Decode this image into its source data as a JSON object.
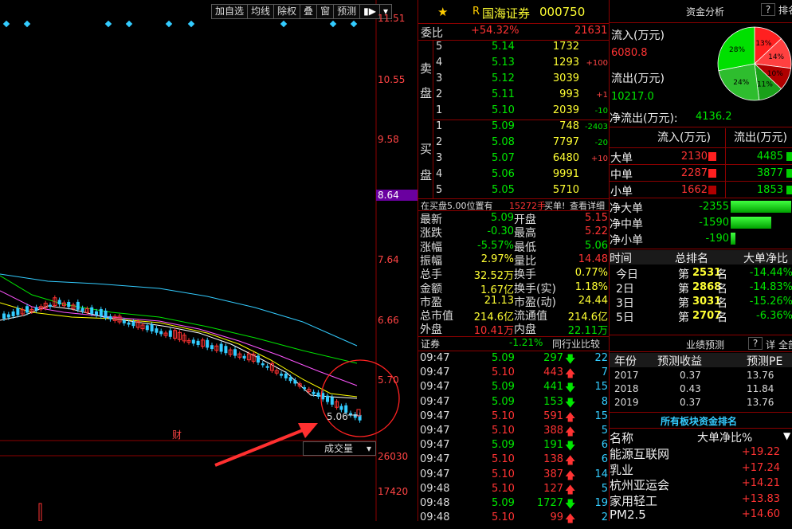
{
  "toolbar": {
    "add": "加自选",
    "ma": "均线",
    "xr": "除权",
    "overlay": "叠",
    "window": "窗",
    "forecast": "预测"
  },
  "price_axis": [
    "11.51",
    "10.55",
    "9.58",
    "8.64",
    "7.64",
    "6.66",
    "5.70"
  ],
  "current_axis_price": "8.64",
  "vol_axis": [
    "26030",
    "17420"
  ],
  "chart": {
    "low_label": "5.06",
    "fin_marker": "财",
    "volume_label": "成交量",
    "lines": {
      "ma1": "#ffffff",
      "ma2": "#ffff00",
      "ma3": "#ff55ff",
      "ma4": "#00e600",
      "ma5": "#33ccff"
    }
  },
  "stock": {
    "flag": "R",
    "name": "国海证券",
    "code": "000750"
  },
  "weibi": {
    "label": "委比",
    "pct": "+54.32%",
    "val": "21631"
  },
  "sell_label": [
    "卖",
    "盘"
  ],
  "buy_label": [
    "买",
    "盘"
  ],
  "sell": [
    {
      "n": "5",
      "p": "5.14",
      "v": "1732",
      "c": ""
    },
    {
      "n": "4",
      "p": "5.13",
      "v": "1293",
      "c": "+100"
    },
    {
      "n": "3",
      "p": "5.12",
      "v": "3039",
      "c": ""
    },
    {
      "n": "2",
      "p": "5.11",
      "v": "993",
      "c": "+1"
    },
    {
      "n": "1",
      "p": "5.10",
      "v": "2039",
      "c": "-10"
    }
  ],
  "buy": [
    {
      "n": "1",
      "p": "5.09",
      "v": "748",
      "c": "-2403"
    },
    {
      "n": "2",
      "p": "5.08",
      "v": "7797",
      "c": "-20"
    },
    {
      "n": "3",
      "p": "5.07",
      "v": "6480",
      "c": "+10"
    },
    {
      "n": "4",
      "p": "5.06",
      "v": "9991",
      "c": ""
    },
    {
      "n": "5",
      "p": "5.05",
      "v": "5710",
      "c": ""
    }
  ],
  "notice": {
    "a": "在买盘5.00位置有",
    "b": "15272手",
    "c": "买单!",
    "d": "查看详细"
  },
  "quote": [
    {
      "l": "最新",
      "v": "5.09",
      "l2": "开盘",
      "v2": "5.15"
    },
    {
      "l": "涨跌",
      "v": "-0.30",
      "l2": "最高",
      "v2": "5.22"
    },
    {
      "l": "涨幅",
      "v": "-5.57%",
      "l2": "最低",
      "v2": "5.06"
    },
    {
      "l": "振幅",
      "v": "2.97%",
      "l2": "量比",
      "v2": "14.48"
    },
    {
      "l": "总手",
      "v": "32.52万",
      "l2": "换手",
      "v2": "0.77%"
    },
    {
      "l": "金额",
      "v": "1.67亿",
      "l2": "换手(实)",
      "v2": "1.18%"
    },
    {
      "l": "市盈",
      "v": "21.13",
      "l2": "市盈(动)",
      "v2": "24.44"
    },
    {
      "l": "总市值",
      "v": "214.6亿",
      "l2": "流通值",
      "v2": "214.6亿"
    },
    {
      "l": "外盘",
      "v": "10.41万",
      "l2": "内盘",
      "v2": "22.11万"
    }
  ],
  "sector": {
    "name": "证券",
    "pct": "-1.21%",
    "btn": "同行业比较"
  },
  "ticks": [
    {
      "t": "09:47",
      "p": "5.09",
      "v": "297",
      "d": "dn",
      "n": "22"
    },
    {
      "t": "09:47",
      "p": "5.10",
      "v": "443",
      "d": "up",
      "n": "7"
    },
    {
      "t": "09:47",
      "p": "5.09",
      "v": "441",
      "d": "dn",
      "n": "15"
    },
    {
      "t": "09:47",
      "p": "5.09",
      "v": "153",
      "d": "dn",
      "n": "8"
    },
    {
      "t": "09:47",
      "p": "5.10",
      "v": "591",
      "d": "up",
      "n": "15"
    },
    {
      "t": "09:47",
      "p": "5.10",
      "v": "388",
      "d": "up",
      "n": "5"
    },
    {
      "t": "09:47",
      "p": "5.09",
      "v": "191",
      "d": "dn",
      "n": "6"
    },
    {
      "t": "09:47",
      "p": "5.10",
      "v": "138",
      "d": "up",
      "n": "6"
    },
    {
      "t": "09:47",
      "p": "5.10",
      "v": "387",
      "d": "up",
      "n": "14"
    },
    {
      "t": "09:48",
      "p": "5.10",
      "v": "127",
      "d": "up",
      "n": "5"
    },
    {
      "t": "09:48",
      "p": "5.09",
      "v": "1727",
      "d": "dn",
      "n": "19"
    },
    {
      "t": "09:48",
      "p": "5.10",
      "v": "99",
      "d": "up",
      "n": "2"
    }
  ],
  "fund": {
    "title": "资金分析",
    "help": "?",
    "rank": "排名",
    "in_label": "流入(万元)",
    "in_val": "6080.8",
    "out_label": "流出(万元)",
    "out_val": "10217.0",
    "net_label": "净流出(万元):",
    "net_val": "4136.2",
    "pie": [
      {
        "label": "13%",
        "color": "#ff2020"
      },
      {
        "label": "14%",
        "color": "#ff4040"
      },
      {
        "label": "10%",
        "color": "#b00000"
      },
      {
        "label": "11%",
        "color": "#1aa01a"
      },
      {
        "label": "24%",
        "color": "#2ebd2e"
      },
      {
        "label": "28%",
        "color": "#00e000"
      }
    ],
    "hdr_in": "流入(万元)",
    "hdr_out": "流出(万元)",
    "rows": [
      {
        "l": "大单",
        "in": "2130",
        "out": "4485"
      },
      {
        "l": "中单",
        "in": "2287",
        "out": "3877"
      },
      {
        "l": "小单",
        "in": "1662",
        "out": "1853"
      }
    ],
    "net": [
      {
        "l": "净大单",
        "v": "-2355",
        "frac": 0.95
      },
      {
        "l": "净中单",
        "v": "-1590",
        "frac": 0.64
      },
      {
        "l": "净小单",
        "v": "-190",
        "frac": 0.08
      }
    ]
  },
  "rank": {
    "h": [
      "时间",
      "总排名",
      "大单净比"
    ],
    "rows": [
      {
        "t": "今日",
        "pre": "第",
        "r": "2531",
        "suf": "名",
        "v": "-14.44%"
      },
      {
        "t": "2日",
        "pre": "第",
        "r": "2868",
        "suf": "名",
        "v": "-14.83%"
      },
      {
        "t": "3日",
        "pre": "第",
        "r": "3031",
        "suf": "名",
        "v": "-15.26%"
      },
      {
        "t": "5日",
        "pre": "第",
        "r": "2707",
        "suf": "名",
        "v": "-6.36%"
      }
    ]
  },
  "forecast": {
    "title": "业绩预测",
    "help": "?",
    "detail": "详",
    "all": "全部",
    "h": [
      "年份",
      "预测收益",
      "预测PE"
    ],
    "rows": [
      {
        "y": "2017",
        "e": "0.37",
        "pe": "13.76"
      },
      {
        "y": "2018",
        "e": "0.43",
        "pe": "11.84"
      },
      {
        "y": "2019",
        "e": "0.37",
        "pe": "13.76"
      }
    ]
  },
  "boards": {
    "title": "所有板块资金排名",
    "h1": "名称",
    "h2": "大单净比%",
    "rows": [
      {
        "n": "能源互联网",
        "v": "+19.22"
      },
      {
        "n": "乳业",
        "v": "+17.24"
      },
      {
        "n": "杭州亚运会",
        "v": "+14.21"
      },
      {
        "n": "家用轻工",
        "v": "+13.83"
      },
      {
        "n": "PM2.5",
        "v": "+14.60"
      }
    ]
  }
}
